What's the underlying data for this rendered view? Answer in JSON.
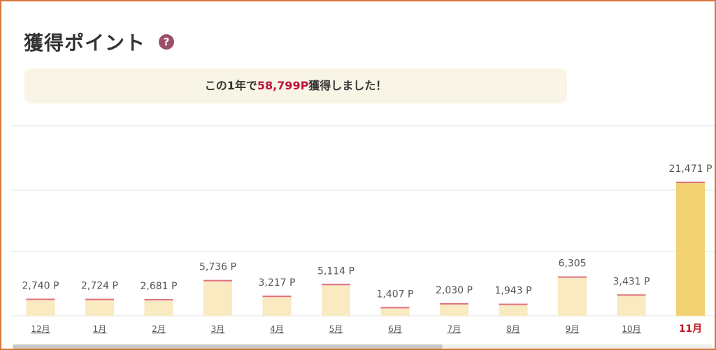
{
  "header": {
    "title": "獲得ポイント",
    "help_icon": "?"
  },
  "summary": {
    "prefix": "この1年で",
    "highlight": "58,799P",
    "suffix": "獲得しました！"
  },
  "colors": {
    "accent": "#c0143c",
    "bar": "#faeac2",
    "bar_current": "#f0d273",
    "border": "#d9763a"
  },
  "chart_data": {
    "type": "bar",
    "unit": "P",
    "categories": [
      "12月",
      "1月",
      "2月",
      "3月",
      "4月",
      "5月",
      "6月",
      "7月",
      "8月",
      "9月",
      "10月",
      "11月"
    ],
    "values": [
      2740,
      2724,
      2681,
      5736,
      3217,
      5114,
      1407,
      2030,
      1943,
      6305,
      3431,
      21471
    ],
    "labels": [
      "2,740 P",
      "2,724 P",
      "2,681 P",
      "5,736 P",
      "3,217 P",
      "5,114 P",
      "1,407 P",
      "2,030 P",
      "1,943 P",
      "6,305",
      "3,431 P",
      "21,471 P"
    ],
    "current_index": 11,
    "grid": true
  }
}
